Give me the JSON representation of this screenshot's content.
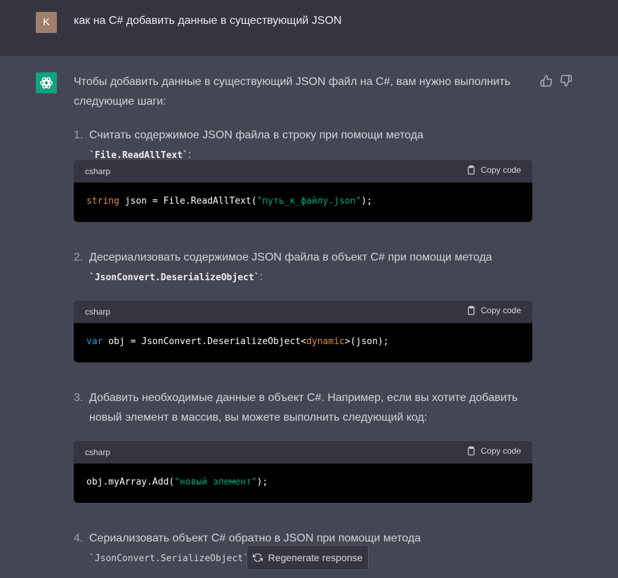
{
  "user": {
    "initial": "K",
    "message": "как на C# добавить данные в существующий JSON"
  },
  "assistant": {
    "intro": "Чтобы добавить данные в существующий JSON файл на C#, вам нужно выполнить следующие шаги:",
    "steps": [
      {
        "num": "1.",
        "text": "Считать содержимое JSON файла в строку при помощи метода ",
        "code": "`File.ReadAllText`",
        "tail": ":"
      },
      {
        "num": "2.",
        "text": "Десериализовать содержимое JSON файла в объект C# при помощи метода ",
        "code": "`JsonConvert.DeserializeObject`",
        "tail": ":"
      },
      {
        "num": "3.",
        "text": "Добавить необходимые данные в объект C#. Например, если вы хотите добавить новый элемент в массив, вы можете выполнить следующий код:"
      },
      {
        "num": "4.",
        "text": "Сериализовать объект C# обратно в JSON при помощи метода ",
        "code": "`JsonConvert.SerializeObject`"
      }
    ],
    "code_blocks": [
      {
        "lang": "csharp",
        "copy_label": "Copy code",
        "t1": "string",
        "t2": " json = File.ReadAllText(",
        "t3": "\"путь_к_файлу.json\"",
        "t4": ");"
      },
      {
        "lang": "csharp",
        "copy_label": "Copy code",
        "t1": "var",
        "t2": " obj = JsonConvert.DeserializeObject<",
        "t3": "dynamic",
        "t4": ">(json);"
      },
      {
        "lang": "csharp",
        "copy_label": "Copy code",
        "t1": "obj.myArray.Add(",
        "t2": "\"новый элемент\"",
        "t3": ");"
      }
    ]
  },
  "regenerate_label": "Regenerate response",
  "colors": {
    "accent": "#10a37f",
    "background": "#444654",
    "header": "#343541"
  }
}
